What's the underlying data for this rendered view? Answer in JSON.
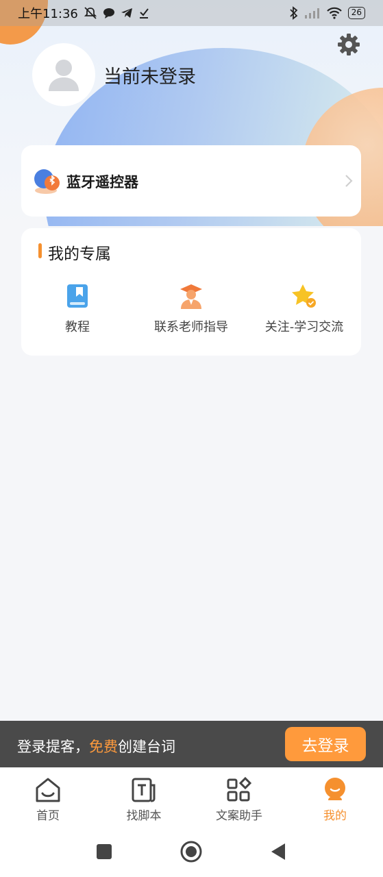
{
  "status_bar": {
    "time": "上午11:36",
    "battery": "26",
    "icons": [
      "mute-icon",
      "chat-bubble-icon",
      "telegram-icon",
      "download-icon",
      "bluetooth-icon",
      "signal-icon",
      "wifi-icon",
      "battery-icon"
    ]
  },
  "profile": {
    "login_status": "当前未登录",
    "settings_icon": "gear-icon",
    "avatar_icon": "user-placeholder-icon"
  },
  "bluetooth_card": {
    "label": "蓝牙遥控器",
    "icon": "bluetooth-remote-icon"
  },
  "exclusive": {
    "title": "我的专属",
    "items": [
      {
        "label": "教程",
        "icon": "book-icon"
      },
      {
        "label": "联系老师指导",
        "icon": "teacher-icon"
      },
      {
        "label": "关注-学习交流",
        "icon": "star-check-icon"
      }
    ]
  },
  "login_banner": {
    "text_prefix": "登录提客，",
    "text_highlight": "免费",
    "text_suffix": "创建台词",
    "button_label": "去登录"
  },
  "tabs": [
    {
      "label": "首页",
      "icon": "home-icon"
    },
    {
      "label": "找脚本",
      "icon": "script-icon"
    },
    {
      "label": "文案助手",
      "icon": "apps-icon"
    },
    {
      "label": "我的",
      "icon": "profile-icon",
      "active": true
    }
  ],
  "colors": {
    "accent": "#f5902f",
    "banner_bg": "#4a4a4a",
    "login_button": "#ff9a3c"
  }
}
